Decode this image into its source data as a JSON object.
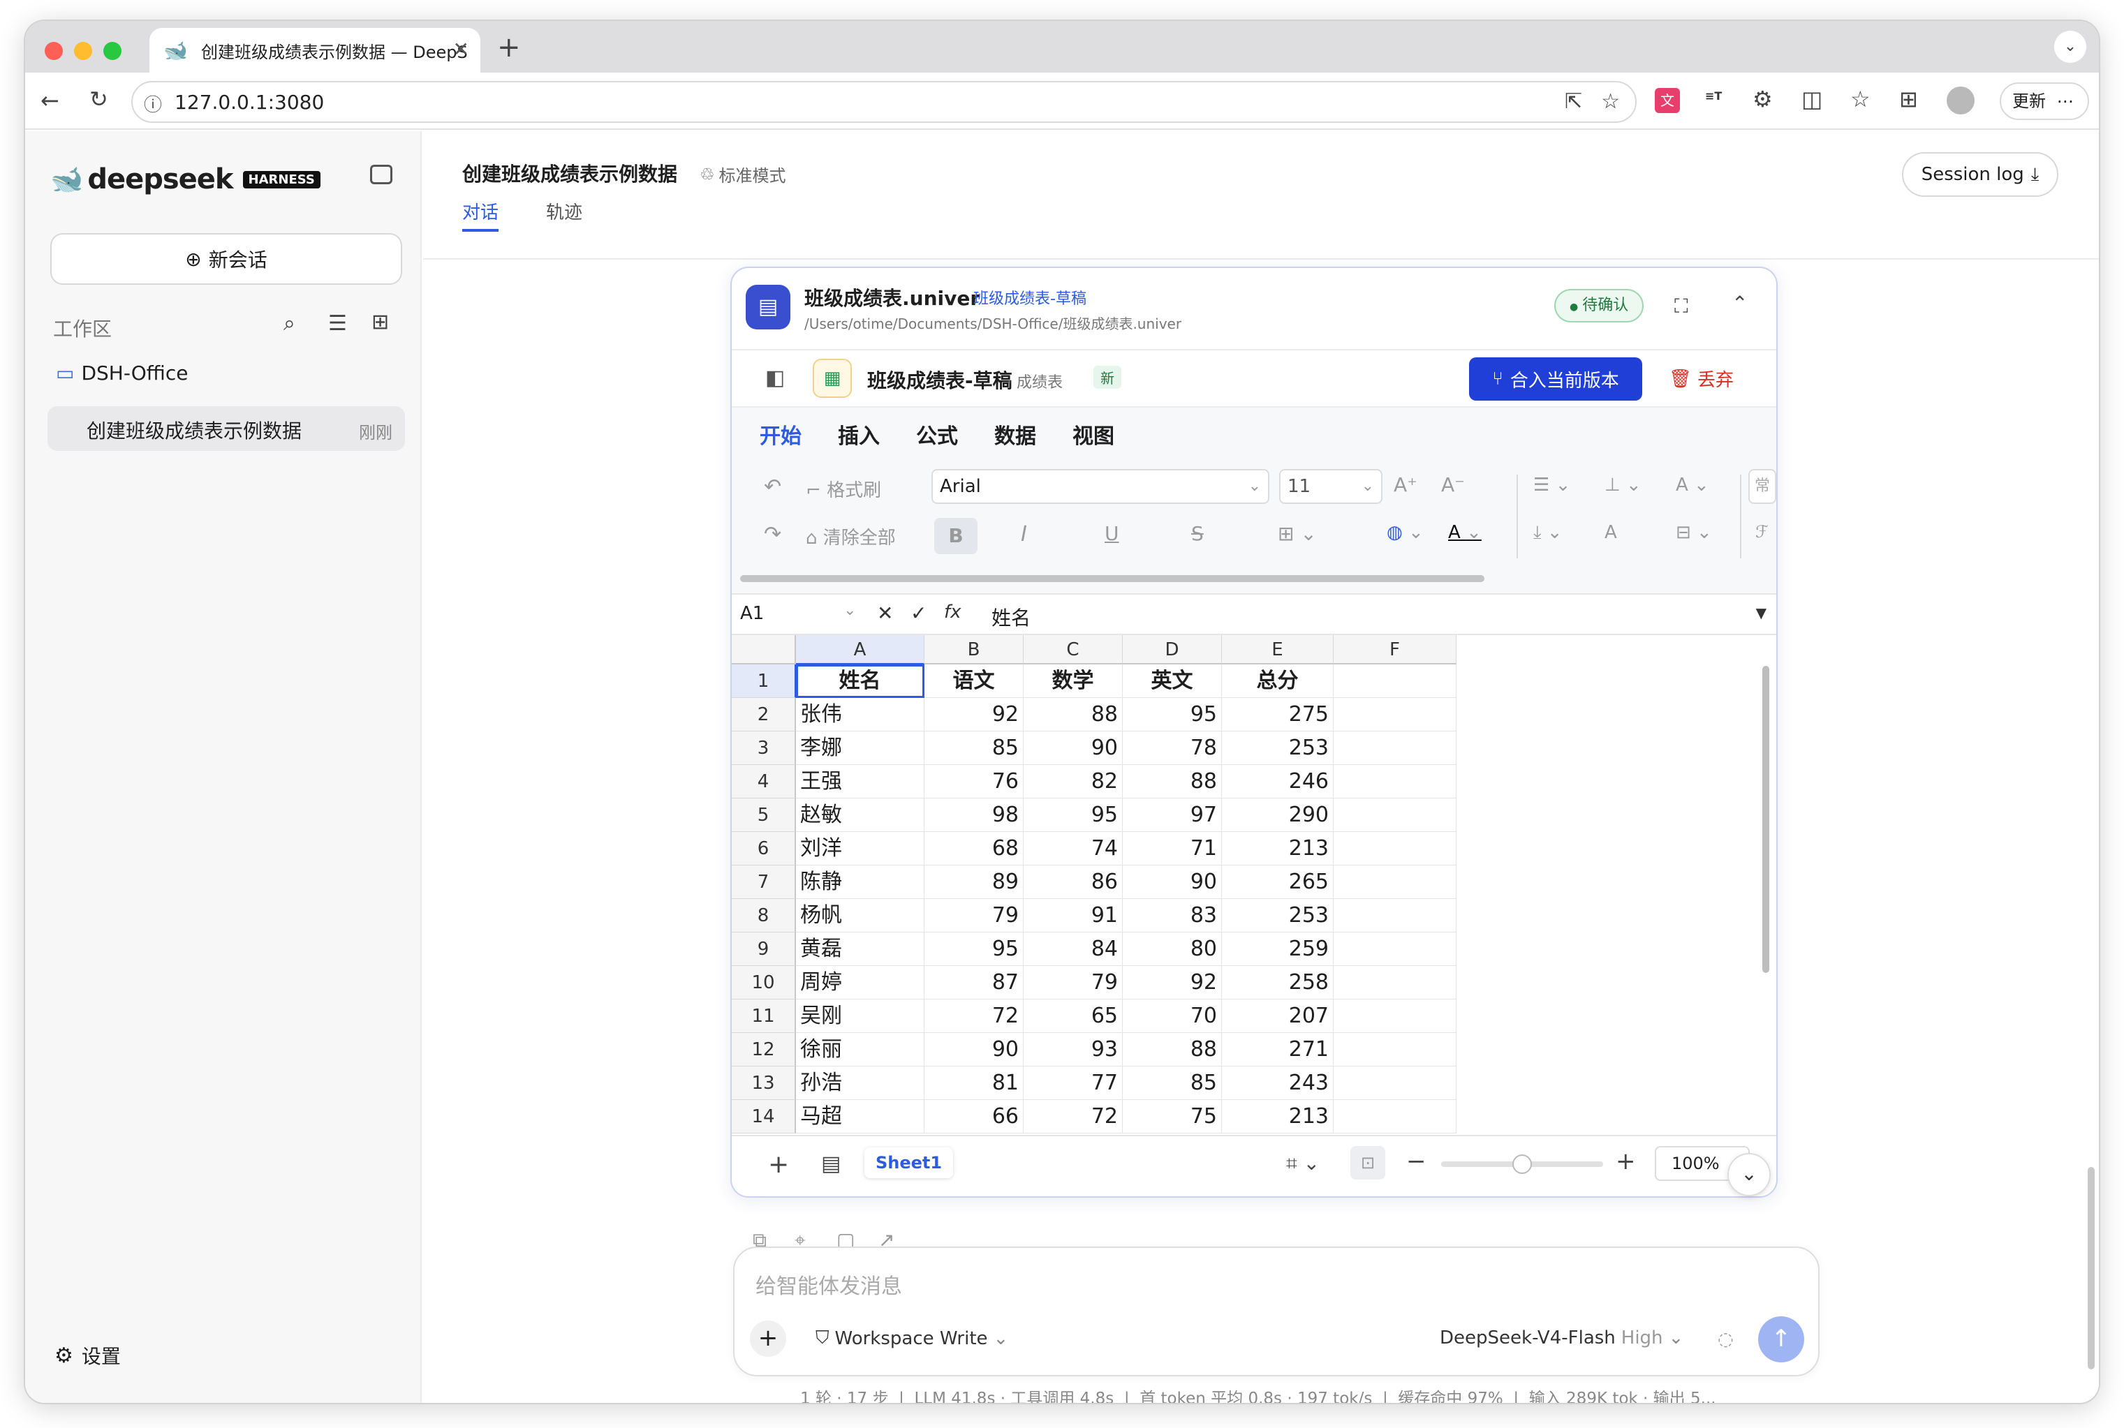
{
  "browser": {
    "tab_title": "创建班级成绩表示例数据 — DeepS",
    "url": "127.0.0.1:3080",
    "update_label": "更新"
  },
  "sidebar": {
    "brand": "deepseek",
    "brand_badge": "HARNESS",
    "new_chat": "新会话",
    "workspace_label": "工作区",
    "folder": "DSH-Office",
    "conversation": {
      "title": "创建班级成绩表示例数据",
      "time": "刚刚"
    },
    "settings": "设置"
  },
  "header": {
    "title": "创建班级成绩表示例数据",
    "mode": "标准模式",
    "tabs": [
      "对话",
      "轨迹"
    ],
    "session_log": "Session log"
  },
  "file_card": {
    "name": "班级成绩表.univer",
    "tag": "班级成绩表-草稿",
    "path": "/Users/otime/Documents/DSH-Office/班级成绩表.univer",
    "status": "待确认",
    "doc_title": "班级成绩表-草稿",
    "doc_sub": "· 成绩表",
    "new_badge": "新",
    "merge_btn": "合入当前版本",
    "discard_btn": "丢弃"
  },
  "ribbon": {
    "tabs": [
      "开始",
      "插入",
      "公式",
      "数据",
      "视图"
    ],
    "format_painter": "格式刷",
    "clear_all": "清除全部",
    "font": "Arial",
    "font_size": "11",
    "overflow": "常"
  },
  "formula_bar": {
    "cell_ref": "A1",
    "fx": "fx",
    "value": "姓名"
  },
  "sheet": {
    "columns": [
      "A",
      "B",
      "C",
      "D",
      "E",
      "F"
    ],
    "header": [
      "姓名",
      "语文",
      "数学",
      "英文",
      "总分",
      ""
    ],
    "rows": [
      [
        "张伟",
        "92",
        "88",
        "95",
        "275"
      ],
      [
        "李娜",
        "85",
        "90",
        "78",
        "253"
      ],
      [
        "王强",
        "76",
        "82",
        "88",
        "246"
      ],
      [
        "赵敏",
        "98",
        "95",
        "97",
        "290"
      ],
      [
        "刘洋",
        "68",
        "74",
        "71",
        "213"
      ],
      [
        "陈静",
        "89",
        "86",
        "90",
        "265"
      ],
      [
        "杨帆",
        "79",
        "91",
        "83",
        "253"
      ],
      [
        "黄磊",
        "95",
        "84",
        "80",
        "259"
      ],
      [
        "周婷",
        "87",
        "79",
        "92",
        "258"
      ],
      [
        "吴刚",
        "72",
        "65",
        "70",
        "207"
      ],
      [
        "徐丽",
        "90",
        "93",
        "88",
        "271"
      ],
      [
        "孙浩",
        "81",
        "77",
        "85",
        "243"
      ],
      [
        "马超",
        "66",
        "72",
        "75",
        "213"
      ]
    ],
    "row_numbers": [
      "1",
      "2",
      "3",
      "4",
      "5",
      "6",
      "7",
      "8",
      "9",
      "10",
      "11",
      "12",
      "13",
      "14"
    ],
    "sheet_tab": "Sheet1",
    "zoom": "100%",
    "zoom_fraction": 0.5
  },
  "composer": {
    "placeholder": "给智能体发消息",
    "permission": "Workspace Write",
    "model": "DeepSeek-V4-Flash",
    "effort": "High"
  },
  "stats": "1 轮 · 17 步  |  LLM 41.8s · 工具调用 4.8s  |  首 token 平均 0.8s · 197 tok/s  |  缓存命中 97%  |  输入 289K tok · 输出 5..."
}
